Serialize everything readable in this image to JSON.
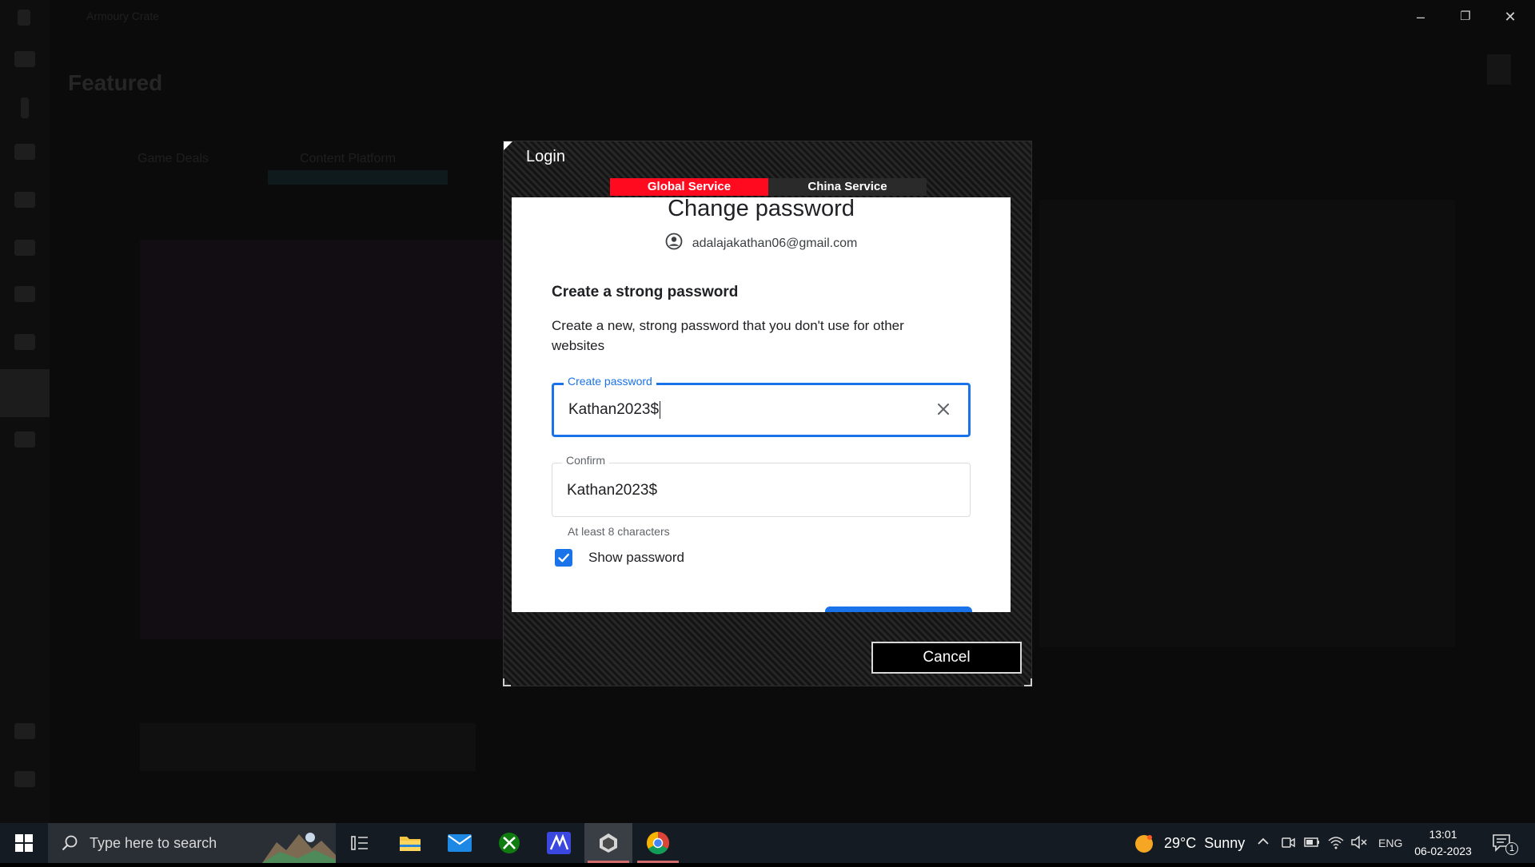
{
  "background_app": {
    "title": "Armoury Crate",
    "page_title": "Featured",
    "tabs": [
      "Game Deals",
      "Content Platform"
    ]
  },
  "window_controls": {
    "minimize": "–",
    "restore": "❐",
    "close": "✕"
  },
  "dialog": {
    "title": "Login",
    "service_tabs": [
      {
        "label": "Global Service",
        "active": true
      },
      {
        "label": "China Service",
        "active": false
      }
    ],
    "heading": "Change password",
    "account_email": "adalajakathan06@gmail.com",
    "section_title": "Create a strong password",
    "section_text": "Create a new, strong password that you don't use for other websites",
    "create_field": {
      "label": "Create password",
      "value": "Kathan2023$"
    },
    "confirm_field": {
      "label": "Confirm",
      "value": "Kathan2023$"
    },
    "hint": "At least 8 characters",
    "show_password": {
      "label": "Show password",
      "checked": true
    },
    "cancel_label": "Cancel"
  },
  "taskbar": {
    "search_placeholder": "Type here to search",
    "apps": [
      "task-view",
      "file-explorer",
      "mail",
      "xbox",
      "media-app",
      "armoury-crate",
      "chrome"
    ],
    "weather": "29°C  Sunny",
    "language": "ENG",
    "time": "13:01",
    "date": "06-02-2023",
    "notification_count": "1"
  },
  "colors": {
    "accent_red": "#ff0a1e",
    "google_blue": "#1a73e8",
    "taskbar": "#151b22"
  }
}
